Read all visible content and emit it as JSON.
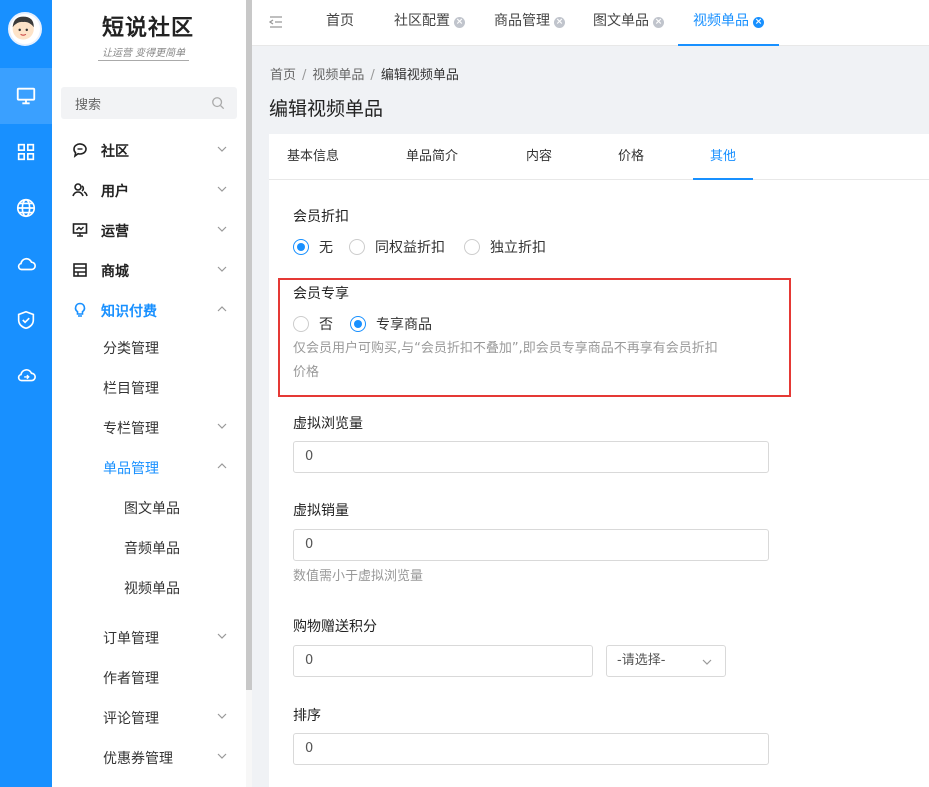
{
  "brand": {
    "title": "短说社区",
    "subtitle": "让运营 变得更简单"
  },
  "rail": [
    {
      "icon": "monitor-icon"
    },
    {
      "icon": "grid-icon"
    },
    {
      "icon": "globe-icon"
    },
    {
      "icon": "cloud-icon"
    },
    {
      "icon": "shield-icon"
    },
    {
      "icon": "cloud-sync-icon"
    }
  ],
  "search": {
    "placeholder": "搜索"
  },
  "sidebar": {
    "items": [
      {
        "label": "社区",
        "icon": "chat-icon"
      },
      {
        "label": "用户",
        "icon": "users-icon"
      },
      {
        "label": "运营",
        "icon": "presentation-icon"
      },
      {
        "label": "商城",
        "icon": "store-icon"
      },
      {
        "label": "知识付费",
        "icon": "bulb-icon"
      }
    ],
    "sub": [
      "分类管理",
      "栏目管理",
      "专栏管理",
      "单品管理",
      "图文单品",
      "音频单品",
      "视频单品",
      "订单管理",
      "作者管理",
      "评论管理",
      "优惠券管理"
    ]
  },
  "tabs": [
    "首页",
    "社区配置",
    "商品管理",
    "图文单品",
    "视频单品"
  ],
  "breadcrumb": [
    "首页",
    "视频单品",
    "编辑视频单品"
  ],
  "page_title": "编辑视频单品",
  "content_tabs": [
    "基本信息",
    "单品简介",
    "内容",
    "价格",
    "其他"
  ],
  "form": {
    "member_discount": {
      "label": "会员折扣",
      "options": [
        "无",
        "同权益折扣",
        "独立折扣"
      ],
      "selected": "无"
    },
    "member_exclusive": {
      "label": "会员专享",
      "options": [
        "否",
        "专享商品"
      ],
      "selected": "专享商品",
      "hint_line1": "仅会员用户可购买,与“会员折扣不叠加”,即会员专享商品不再享有会员折扣",
      "hint_line2": "价格"
    },
    "virtual_views": {
      "label": "虚拟浏览量",
      "value": "0"
    },
    "virtual_sales": {
      "label": "虚拟销量",
      "value": "0",
      "hint": "数值需小于虚拟浏览量"
    },
    "bonus_points": {
      "label": "购物赠送积分",
      "value": "0",
      "select": "-请选择-"
    },
    "sort": {
      "label": "排序",
      "value": "0"
    }
  },
  "colors": {
    "primary": "#1890ff",
    "highlight": "#e53935"
  }
}
